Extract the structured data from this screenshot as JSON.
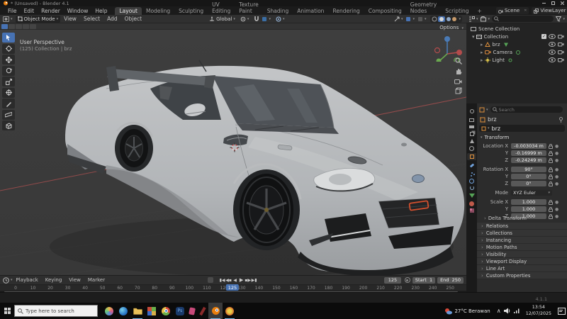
{
  "titlebar": {
    "title": "* (Unsaved) - Blender 4.1"
  },
  "menubar": {
    "menus": [
      "File",
      "Edit",
      "Render",
      "Window",
      "Help"
    ],
    "tabs": [
      "Layout",
      "Modeling",
      "Sculpting",
      "UV Editing",
      "Texture Paint",
      "Shading",
      "Animation",
      "Rendering",
      "Compositing",
      "Geometry Nodes",
      "Scripting",
      "+"
    ],
    "active_tab": "Layout",
    "scene_label": "Scene",
    "viewlayer_label": "ViewLayer"
  },
  "viewport_header": {
    "mode": "Object Mode",
    "menus": [
      "View",
      "Select",
      "Add",
      "Object"
    ],
    "orientation": "Global",
    "options_label": "Options"
  },
  "viewport": {
    "overlay_line1": "User Perspective",
    "overlay_line2": "(125) Collection | brz"
  },
  "outliner": {
    "rows": [
      {
        "label": "Scene Collection"
      },
      {
        "label": "Collection"
      },
      {
        "label": "brz"
      },
      {
        "label": "Camera"
      },
      {
        "label": "Light"
      }
    ]
  },
  "properties": {
    "search_placeholder": "Search",
    "breadcrumb_object": "brz",
    "name_value": "brz",
    "transform": {
      "title": "Transform",
      "rows": [
        {
          "label": "Location X",
          "value": "-0.003034 m"
        },
        {
          "label": "Y",
          "value": "-0.16999 m"
        },
        {
          "label": "Z",
          "value": "-0.24249 m"
        },
        {
          "label": "Rotation X",
          "value": "90°"
        },
        {
          "label": "Y",
          "value": "0°"
        },
        {
          "label": "Z",
          "value": "0°"
        },
        {
          "label": "Mode",
          "value": "XYZ Euler"
        },
        {
          "label": "Scale X",
          "value": "1.000"
        },
        {
          "label": "Y",
          "value": "1.000"
        },
        {
          "label": "Z",
          "value": "1.000"
        }
      ]
    },
    "delta_label": "Delta Transform",
    "panels": [
      "Relations",
      "Collections",
      "Instancing",
      "Motion Paths",
      "Visibility",
      "Viewport Display",
      "Line Art",
      "Custom Properties"
    ]
  },
  "timeline": {
    "menus": [
      "Playback",
      "Keying",
      "View",
      "Marker"
    ],
    "current_frame": "125",
    "start_label": "Start",
    "start_value": "1",
    "end_label": "End",
    "end_value": "250",
    "ticks": [
      "0",
      "10",
      "20",
      "30",
      "40",
      "50",
      "60",
      "70",
      "80",
      "90",
      "100",
      "110",
      "120",
      "130",
      "140",
      "150",
      "160",
      "170",
      "180",
      "190",
      "200",
      "210",
      "220",
      "230",
      "240",
      "250"
    ]
  },
  "statusbar": {
    "version": "4.1.1"
  },
  "taskbar": {
    "search_placeholder": "Type here to search",
    "tray": {
      "weather": "27°C  Berawan",
      "time": "13:54",
      "date": "12/07/2025"
    }
  },
  "colors": {
    "accent": "#4772b3",
    "blender_orange": "#e87d0d",
    "axis_x": "#b05050"
  }
}
